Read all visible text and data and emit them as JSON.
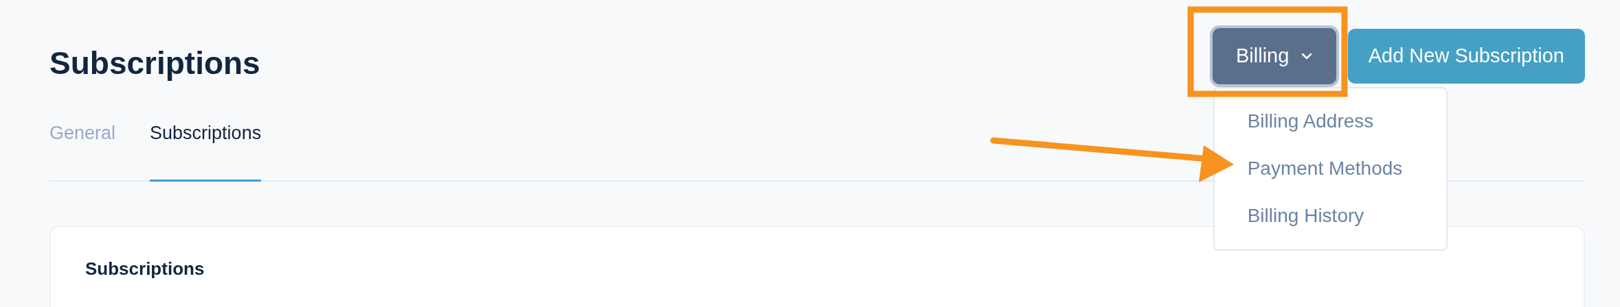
{
  "header": {
    "title": "Subscriptions"
  },
  "actions": {
    "menu_button": {
      "label": "Billing",
      "expanded": true
    },
    "primary_button": {
      "label": "Add New Subscription"
    }
  },
  "dropdown": {
    "items": [
      {
        "label": "Billing Address"
      },
      {
        "label": "Payment Methods"
      },
      {
        "label": "Billing History"
      }
    ]
  },
  "tabs": [
    {
      "label": "General",
      "selected": false
    },
    {
      "label": "Subscriptions",
      "selected": true
    }
  ],
  "card": {
    "title": "Subscriptions"
  }
}
